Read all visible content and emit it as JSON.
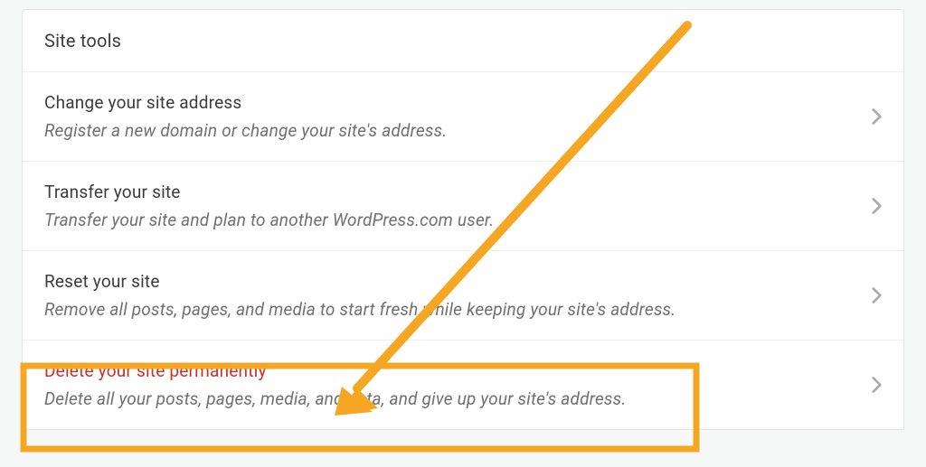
{
  "panel": {
    "heading": "Site tools",
    "rows": [
      {
        "title": "Change your site address",
        "desc": "Register a new domain or change your site's address."
      },
      {
        "title": "Transfer your site",
        "desc": "Transfer your site and plan to another WordPress.com user."
      },
      {
        "title": "Reset your site",
        "desc": "Remove all posts, pages, and media to start fresh while keeping your site's address."
      },
      {
        "title": "Delete your site permanently",
        "desc": "Delete all your posts, pages, media, and data, and give up your site's address."
      }
    ]
  },
  "annotation": {
    "highlight_color": "#f5a623"
  }
}
